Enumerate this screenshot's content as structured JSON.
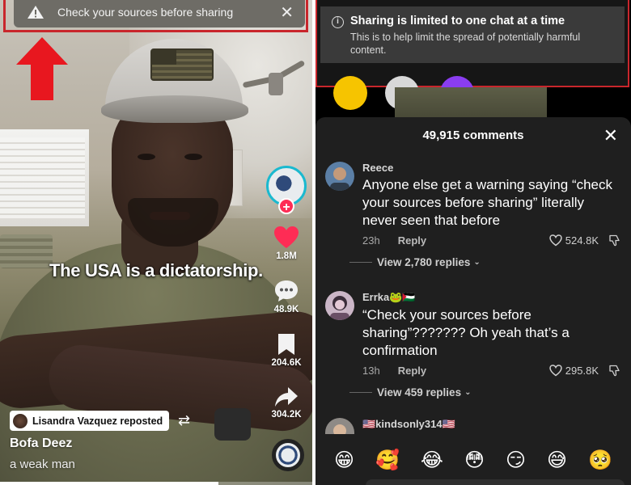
{
  "left": {
    "warning_banner": {
      "text": "Check your sources before sharing",
      "close": "✕"
    },
    "caption": "The USA is a dictatorship.",
    "actions": [
      {
        "name": "like",
        "count": "1.8M"
      },
      {
        "name": "comment",
        "count": "48.9K"
      },
      {
        "name": "bookmark",
        "count": "204.6K"
      },
      {
        "name": "share",
        "count": "304.2K"
      }
    ],
    "repost_label": "Lisandra Vazquez reposted",
    "username": "Bofa Deez",
    "description": "a weak man",
    "progress": 0.7
  },
  "right": {
    "banner": {
      "title": "Sharing is limited to one chat at a time",
      "subtitle": "This is to help limit the spread of potentially harmful content."
    },
    "comments_header": "49,915 comments",
    "close": "✕",
    "comments": [
      {
        "user": "Reece",
        "text": "Anyone else get a warning saying “check your sources before sharing” literally never seen that before",
        "time": "23h",
        "reply": "Reply",
        "likes": "524.8K",
        "view_replies": "View 2,780 replies"
      },
      {
        "user": "Errka🐸🇵🇸",
        "text": "“Check your sources before sharing”??????? Oh yeah that’s a confirmation",
        "time": "13h",
        "reply": "Reply",
        "likes": "295.8K",
        "view_replies": "View 459 replies"
      },
      {
        "user": "🇺🇸kindsonly314🇺🇸"
      }
    ],
    "emojis": [
      "😁",
      "🥰",
      "😂",
      "😳",
      "😏",
      "😅",
      "🥺"
    ]
  },
  "colors": {
    "highlight": "#c9262c",
    "tiktok_red": "#fe2c55",
    "arrow": "#e8171f"
  }
}
